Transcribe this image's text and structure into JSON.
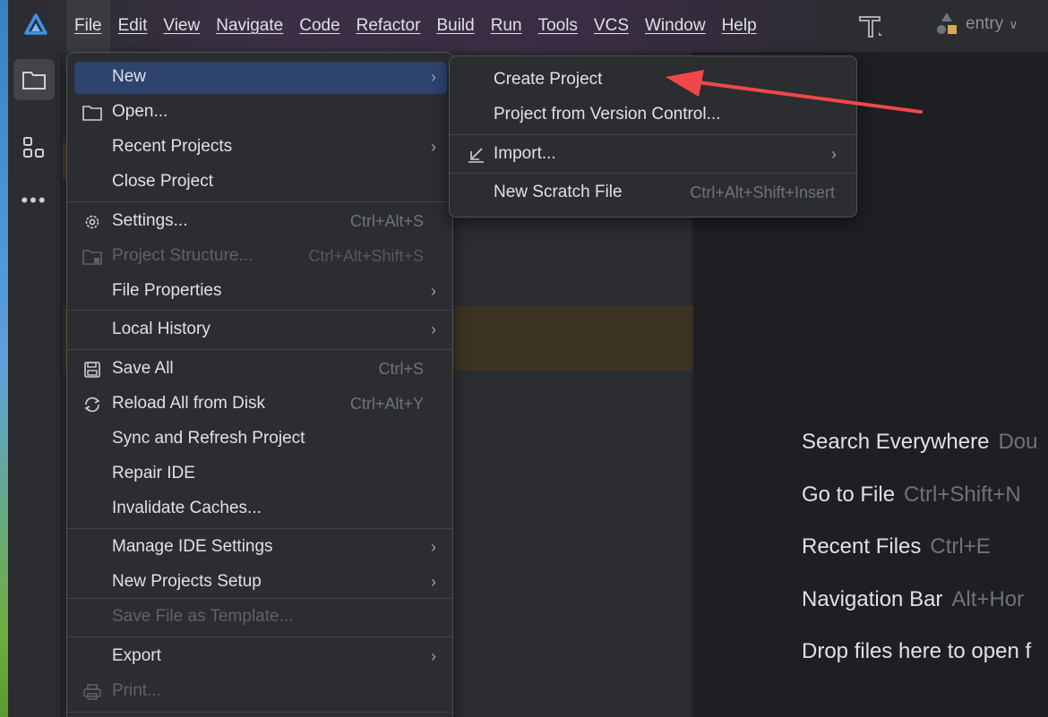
{
  "menubar": {
    "items": [
      "File",
      "Edit",
      "View",
      "Navigate",
      "Code",
      "Refactor",
      "Build",
      "Run",
      "Tools",
      "VCS",
      "Window",
      "Help"
    ],
    "active_index": 0
  },
  "toolbar": {
    "run_config": "entry"
  },
  "file_menu": {
    "items": [
      {
        "label": "New",
        "shortcut": "",
        "has_submenu": true,
        "disabled": false,
        "icon": "",
        "selected": true
      },
      {
        "label": "Open...",
        "shortcut": "",
        "has_submenu": false,
        "disabled": false,
        "icon": "folder-icon"
      },
      {
        "label": "Recent Projects",
        "shortcut": "",
        "has_submenu": true,
        "disabled": false,
        "icon": ""
      },
      {
        "label": "Close Project",
        "shortcut": "",
        "has_submenu": false,
        "disabled": false,
        "icon": ""
      },
      {
        "label": "Settings...",
        "shortcut": "Ctrl+Alt+S",
        "has_submenu": false,
        "disabled": false,
        "icon": "gear-icon"
      },
      {
        "label": "Project Structure...",
        "shortcut": "Ctrl+Alt+Shift+S",
        "has_submenu": false,
        "disabled": true,
        "icon": "project-structure-icon"
      },
      {
        "label": "File Properties",
        "shortcut": "",
        "has_submenu": true,
        "disabled": false,
        "icon": ""
      },
      {
        "label": "Local History",
        "shortcut": "",
        "has_submenu": true,
        "disabled": false,
        "icon": ""
      },
      {
        "label": "Save All",
        "shortcut": "Ctrl+S",
        "has_submenu": false,
        "disabled": false,
        "icon": "save-icon"
      },
      {
        "label": "Reload All from Disk",
        "shortcut": "Ctrl+Alt+Y",
        "has_submenu": false,
        "disabled": false,
        "icon": "reload-icon"
      },
      {
        "label": "Sync and Refresh Project",
        "shortcut": "",
        "has_submenu": false,
        "disabled": false,
        "icon": ""
      },
      {
        "label": "Repair IDE",
        "shortcut": "",
        "has_submenu": false,
        "disabled": false,
        "icon": ""
      },
      {
        "label": "Invalidate Caches...",
        "shortcut": "",
        "has_submenu": false,
        "disabled": false,
        "icon": ""
      },
      {
        "label": "Manage IDE Settings",
        "shortcut": "",
        "has_submenu": true,
        "disabled": false,
        "icon": ""
      },
      {
        "label": "New Projects Setup",
        "shortcut": "",
        "has_submenu": true,
        "disabled": false,
        "icon": ""
      },
      {
        "label": "Save File as Template...",
        "shortcut": "",
        "has_submenu": false,
        "disabled": true,
        "icon": ""
      },
      {
        "label": "Export",
        "shortcut": "",
        "has_submenu": true,
        "disabled": false,
        "icon": ""
      },
      {
        "label": "Print...",
        "shortcut": "",
        "has_submenu": false,
        "disabled": true,
        "icon": "print-icon"
      }
    ]
  },
  "new_submenu": {
    "items": [
      {
        "label": "Create Project",
        "shortcut": "",
        "has_submenu": false,
        "icon": ""
      },
      {
        "label": "Project from Version Control...",
        "shortcut": "",
        "has_submenu": false,
        "icon": ""
      },
      {
        "label": "Import...",
        "shortcut": "",
        "has_submenu": true,
        "icon": "import-icon"
      },
      {
        "label": "New Scratch File",
        "shortcut": "Ctrl+Alt+Shift+Insert",
        "has_submenu": false,
        "icon": ""
      }
    ]
  },
  "editor_hints": [
    {
      "label": "Search Everywhere",
      "shortcut": "Dou"
    },
    {
      "label": "Go to File",
      "shortcut": "Ctrl+Shift+N"
    },
    {
      "label": "Recent Files",
      "shortcut": "Ctrl+E"
    },
    {
      "label": "Navigation Bar",
      "shortcut": "Alt+Hor"
    },
    {
      "label": "Drop files here to open f",
      "shortcut": ""
    }
  ],
  "colors": {
    "menu_selection": "#2e436e",
    "annotation_arrow": "#f0474b",
    "background": "#2b2d30",
    "editor_bg": "#1e1f22"
  },
  "icons": {
    "submenu_arrow": "›"
  }
}
